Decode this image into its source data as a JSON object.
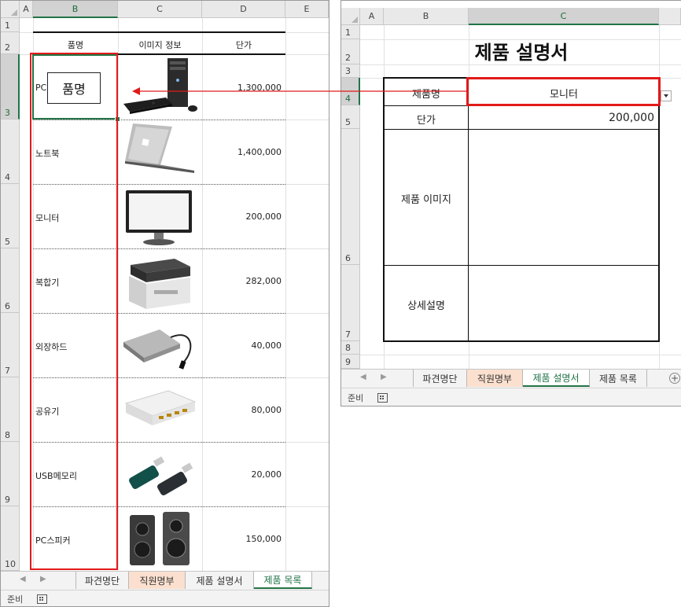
{
  "left_sheet": {
    "columns": [
      "A",
      "B",
      "C",
      "D",
      "E"
    ],
    "rows": [
      "1",
      "2",
      "3",
      "4",
      "5",
      "6",
      "7",
      "8",
      "9",
      "10"
    ],
    "headers": {
      "name": "품명",
      "image": "이미지 정보",
      "price": "단가"
    },
    "items": [
      {
        "name": "PC",
        "price": "1,300,000",
        "icon": "desktop-pc-icon"
      },
      {
        "name": "노트북",
        "price": "1,400,000",
        "icon": "laptop-icon"
      },
      {
        "name": "모니터",
        "price": "200,000",
        "icon": "monitor-icon"
      },
      {
        "name": "복합기",
        "price": "282,000",
        "icon": "printer-icon"
      },
      {
        "name": "외장하드",
        "price": "40,000",
        "icon": "external-hdd-icon"
      },
      {
        "name": "공유기",
        "price": "80,000",
        "icon": "router-icon"
      },
      {
        "name": "USB메모리",
        "price": "20,000",
        "icon": "usb-memory-icon"
      },
      {
        "name": "PC스피커",
        "price": "150,000",
        "icon": "speaker-icon"
      }
    ],
    "callout": "품명",
    "tabs": [
      "파견명단",
      "직원명부",
      "제품 설명서",
      "제품 목록"
    ],
    "active_tab": "제품 목록",
    "status": "준비"
  },
  "right_sheet": {
    "columns": [
      "A",
      "B",
      "C"
    ],
    "rows": [
      "1",
      "2",
      "3",
      "4",
      "5",
      "6",
      "7",
      "8",
      "9"
    ],
    "title": "제품 설명서",
    "labels": {
      "product_name": "제품명",
      "price": "단가",
      "image": "제품 이미지",
      "detail": "상세설명"
    },
    "values": {
      "product_name": "모니터",
      "price": "200,000"
    },
    "tabs": [
      "파견명단",
      "직원명부",
      "제품 설명서",
      "제품 목록"
    ],
    "active_tab": "제품 설명서",
    "status": "준비",
    "add_sheet": "+"
  },
  "colors": {
    "accent": "#217346",
    "highlight": "#e21a1a",
    "orange_tab": "#fbe0cf"
  }
}
